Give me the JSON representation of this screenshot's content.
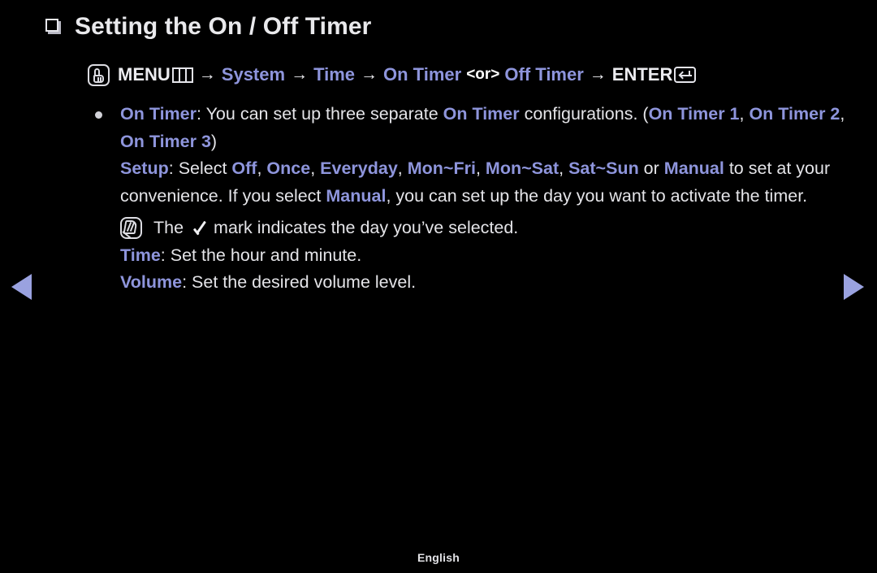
{
  "page": {
    "background_color": "#000000",
    "accent_color": "#8e95dc",
    "text_color": "#e4e4e8",
    "arrow_color": "#9aa2e0",
    "title": "Setting the On / Off Timer",
    "footer_language": "English"
  },
  "menu_path": {
    "menu_label": "MENU",
    "menu_icon": "hand-touch-icon",
    "grid_icon": "menu-grid-icon",
    "segments": [
      {
        "label": "System",
        "accent": true
      },
      {
        "label": "Time",
        "accent": true
      },
      {
        "label": "On Timer",
        "accent": true
      },
      {
        "label": "Off Timer",
        "accent": true
      }
    ],
    "or_label": "<or>",
    "enter_label": "ENTER",
    "enter_icon": "enter-return-icon",
    "arrow_glyph": "→"
  },
  "content": {
    "bullet_glyph": "•",
    "paragraph_1": {
      "term": "On Timer",
      "colon": ": ",
      "text_a": "You can set up three separate ",
      "term_b": "On Timer",
      "text_b": " configurations. (",
      "item_1": "On Timer 1",
      "sep_1": ", ",
      "item_2": "On Timer 2",
      "sep_2": ", ",
      "item_3": "On Timer 3",
      "close": ")"
    },
    "paragraph_2": {
      "term": "Setup",
      "colon": ": ",
      "text_a": "Select ",
      "options": [
        "Off",
        "Once",
        "Everyday",
        "Mon~Fri",
        "Mon~Sat",
        "Sat~Sun"
      ],
      "separator": ", ",
      "text_or": " or ",
      "term_manual": "Manual",
      "text_b": " to set at your convenience. If you select ",
      "term_manual_2": "Manual",
      "text_c": ", you can set up the day you want to activate the timer."
    },
    "note": {
      "icon": "note-pen-icon",
      "text_a": "The ",
      "check_icon": "check-mark-icon",
      "text_b": "mark indicates the day you’ve selected."
    },
    "paragraph_3": {
      "term": "Time",
      "colon": ": ",
      "text": "Set the hour and minute."
    },
    "paragraph_4": {
      "term": "Volume",
      "colon": ": ",
      "text": "Set the desired volume level."
    }
  },
  "nav": {
    "prev_label": "previous-page",
    "next_label": "next-page"
  }
}
